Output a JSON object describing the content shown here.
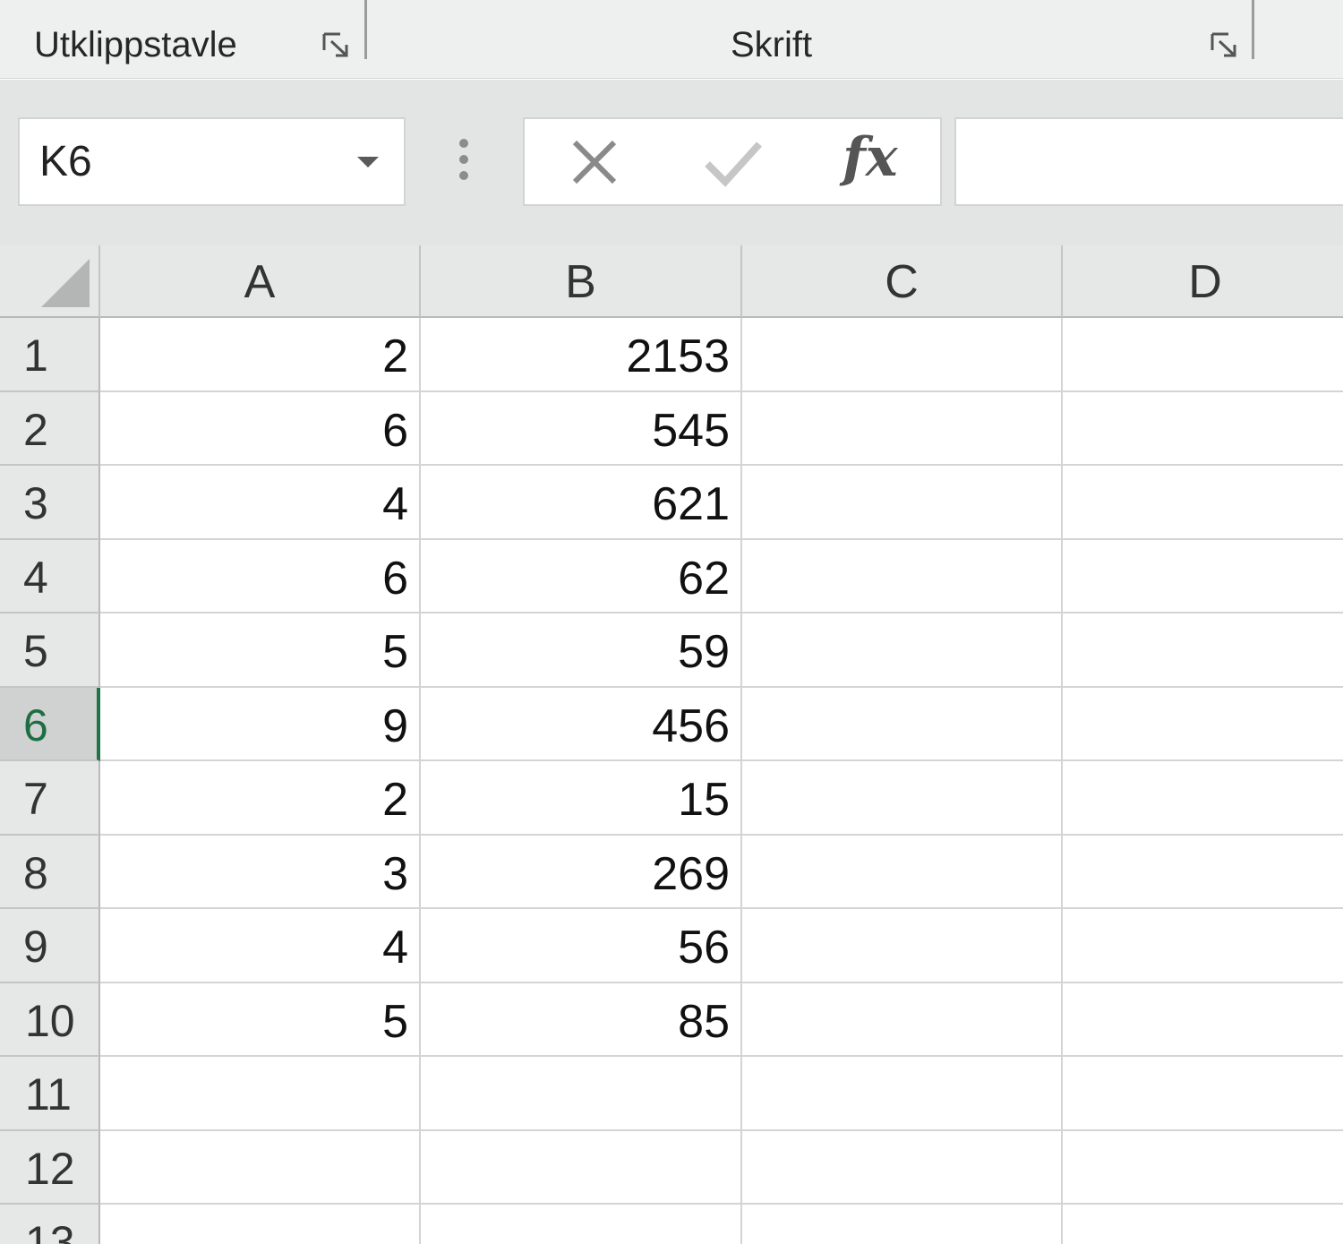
{
  "ribbon": {
    "groups": [
      {
        "label": "Utklippstavle"
      },
      {
        "label": "Skrift"
      }
    ]
  },
  "formula_bar": {
    "name_box": "K6",
    "formula_value": "",
    "fx_label": "fx"
  },
  "sheet": {
    "columns": [
      "A",
      "B",
      "C",
      "D"
    ],
    "rows": [
      "1",
      "2",
      "3",
      "4",
      "5",
      "6",
      "7",
      "8",
      "9",
      "10",
      "11",
      "12",
      "13"
    ],
    "selected_row": "6",
    "cells": {
      "A": [
        "2",
        "6",
        "4",
        "6",
        "5",
        "9",
        "2",
        "3",
        "4",
        "5",
        "",
        "",
        ""
      ],
      "B": [
        "2153",
        "545",
        "621",
        "62",
        "59",
        "456",
        "15",
        "269",
        "56",
        "85",
        "",
        "",
        ""
      ],
      "C": [
        "",
        "",
        "",
        "",
        "",
        "",
        "",
        "",
        "",
        "",
        "",
        "",
        ""
      ],
      "D": [
        "",
        "",
        "",
        "",
        "",
        "",
        "",
        "",
        "",
        "",
        "",
        "",
        ""
      ]
    }
  },
  "colors": {
    "accent": "#217346",
    "header_bg": "#e6e8e7",
    "gridline": "#d4d4d4"
  }
}
